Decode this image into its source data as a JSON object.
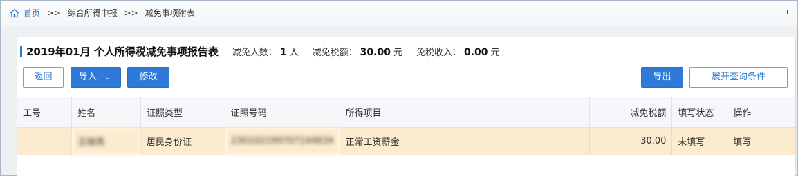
{
  "breadcrumb": {
    "home": "首页",
    "separator": ">>",
    "items": [
      "综合所得申报",
      "减免事项附表"
    ]
  },
  "report": {
    "title": "2019年01月  个人所得税减免事项报告表",
    "stats": [
      {
        "label": "减免人数：",
        "value": "1",
        "unit": "人"
      },
      {
        "label": "减免税额：",
        "value": "30.00",
        "unit": "元"
      },
      {
        "label": "免税收入：",
        "value": "0.00",
        "unit": "元"
      }
    ]
  },
  "toolbar": {
    "back_label": "返回",
    "import_label": "导入",
    "modify_label": "修改",
    "export_label": "导出",
    "expand_query_label": "展开查询条件"
  },
  "table": {
    "columns": [
      "工号",
      "姓名",
      "证照类型",
      "证照号码",
      "所得项目",
      "减免税额",
      "填写状态",
      "操作"
    ],
    "rows": [
      {
        "emp_id": "",
        "name": "王晓燕",
        "id_type": "居民身份证",
        "id_number": "230102199707144834",
        "income_item": "正常工资薪金",
        "tax_reduction": "30.00",
        "status": "未填写",
        "action": "填写"
      }
    ]
  },
  "colors": {
    "accent": "#2f7ad8",
    "row_highlight": "#fdebd0",
    "link": "#2a7bd2"
  }
}
